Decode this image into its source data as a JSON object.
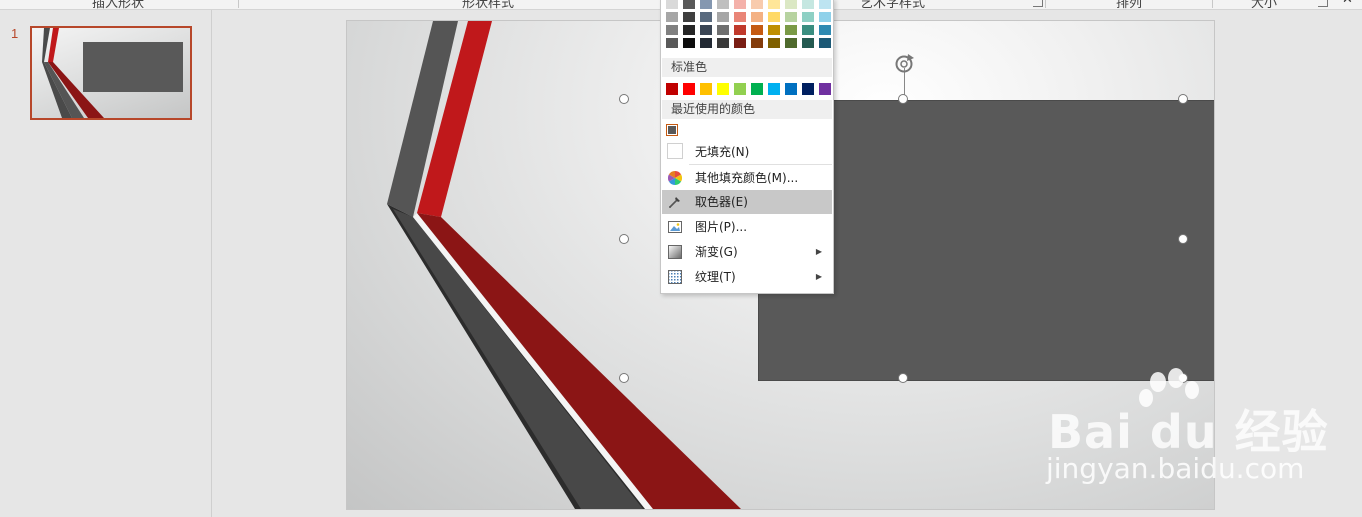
{
  "ribbon": {
    "groups": [
      "插入形状",
      "形状样式",
      "艺术字样式",
      "排列",
      "大小"
    ]
  },
  "thumbnails": [
    {
      "number": "1"
    }
  ],
  "menu": {
    "theme_colors": [
      [
        "#d9d9d9",
        "#a6a6a6",
        "#808080",
        "#595959"
      ],
      [
        "#595959",
        "#3f3f3f",
        "#262626",
        "#0d0d0d"
      ],
      [
        "#8497b0",
        "#596a7e",
        "#3a4554",
        "#222933"
      ],
      [
        "#bfbfbf",
        "#a6a6a6",
        "#6f6f6f",
        "#3a3a3a"
      ],
      [
        "#f4b1aa",
        "#e98577",
        "#c0392b",
        "#7a1e14"
      ],
      [
        "#f8cbad",
        "#f4b183",
        "#c55a11",
        "#833c0b"
      ],
      [
        "#ffe699",
        "#ffd966",
        "#bf8f00",
        "#7f6000"
      ],
      [
        "#dbe8c4",
        "#b7d3a0",
        "#7a9a46",
        "#4f6a2d"
      ],
      [
        "#c5e7e1",
        "#8ed0c4",
        "#3a8e80",
        "#245a51"
      ],
      [
        "#bde4f1",
        "#8fd1ea",
        "#2f8ab2",
        "#1c5976"
      ]
    ],
    "standard_label": "标准色",
    "standard_colors": [
      "#c00000",
      "#ff0000",
      "#ffc000",
      "#ffff00",
      "#92d050",
      "#00b050",
      "#00b0f0",
      "#0070c0",
      "#002060",
      "#7030a0"
    ],
    "recent_label": "最近使用的颜色",
    "recent_color": "#595959",
    "items": [
      {
        "label": "无填充(N)",
        "icon": "no-fill-icon"
      },
      {
        "label": "其他填充颜色(M)...",
        "icon": "color-wheel-icon"
      },
      {
        "label": "取色器(E)",
        "icon": "eyedropper-icon",
        "highlighted": true
      },
      {
        "label": "图片(P)...",
        "icon": "picture-icon"
      },
      {
        "label": "渐变(G)",
        "icon": "gradient-icon",
        "submenu": true
      },
      {
        "label": "纹理(T)",
        "icon": "texture-icon",
        "submenu": true
      }
    ]
  },
  "watermark": {
    "brand": "Bai du 经验",
    "url": "jingyan.baidu.com"
  },
  "colors": {
    "accent": "#b7472a",
    "shape_fill": "#595959",
    "ribbon_red": "#c0181b",
    "ribbon_dark": "#4a4a4a"
  }
}
